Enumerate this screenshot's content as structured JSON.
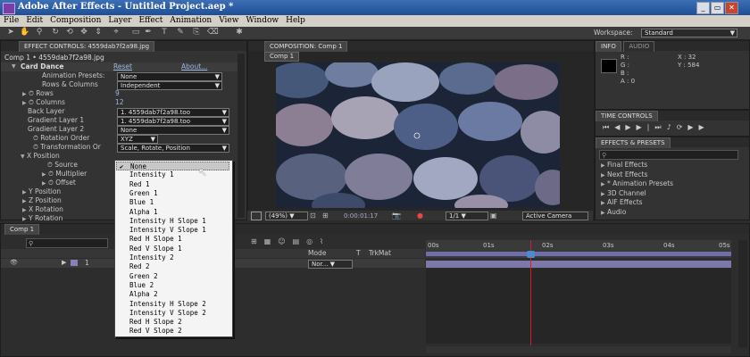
{
  "app": {
    "title": "Adobe After Effects - Untitled Project.aep *"
  },
  "menu": [
    "File",
    "Edit",
    "Composition",
    "Layer",
    "Effect",
    "Animation",
    "View",
    "Window",
    "Help"
  ],
  "workspace": {
    "label": "Workspace:",
    "value": "Standard"
  },
  "effect_controls": {
    "tab": "EFFECT CONTROLS: 4559dab7f2a98.jpg",
    "layer_path": "Comp 1 • 4559dab7f2a98.jpg",
    "effect_name": "Card Dance",
    "reset": "Reset",
    "about": "About...",
    "rows": [
      {
        "label": "Animation Presets:",
        "value": "None"
      },
      {
        "label": "Rows & Columns",
        "value": "Independent"
      },
      {
        "label": "Rows",
        "value": "9"
      },
      {
        "label": "Columns",
        "value": "12"
      },
      {
        "label": "Back Layer",
        "value": "1. 4559dab7f2a98.too"
      },
      {
        "label": "Gradient Layer 1",
        "value": "1. 4559dab7f2a98.too"
      },
      {
        "label": "Gradient Layer 2",
        "value": "None"
      },
      {
        "label": "Rotation Order",
        "value": "XYZ"
      },
      {
        "label": "Transformation Or",
        "value": "Scale, Rotate, Position"
      },
      {
        "label": "X Position",
        "value": ""
      },
      {
        "label": "Source",
        "value": ""
      },
      {
        "label": "Multiplier",
        "value": ""
      },
      {
        "label": "Offset",
        "value": ""
      },
      {
        "label": "Y Position",
        "value": ""
      },
      {
        "label": "Z Position",
        "value": ""
      },
      {
        "label": "X Rotation",
        "value": ""
      },
      {
        "label": "Y Rotation",
        "value": ""
      }
    ]
  },
  "source_menu": {
    "items": [
      "None",
      "Intensity 1",
      "Red 1",
      "Green 1",
      "Blue 1",
      "Alpha 1",
      "Intensity H Slope 1",
      "Intensity V Slope 1",
      "Red H Slope 1",
      "Red V Slope 1",
      "Intensity 2",
      "Red 2",
      "Green 2",
      "Blue 2",
      "Alpha 2",
      "Intensity H Slope 2",
      "Intensity V Slope 2",
      "Red H Slope 2",
      "Red V Slope 2"
    ],
    "selected": "None"
  },
  "composition": {
    "tab": "COMPOSITION: Comp 1",
    "sub_tab": "Comp 1",
    "zoom": "(49%)",
    "timecode": "0:00:01:17",
    "resolution": "1/1",
    "camera": "Active Camera"
  },
  "info": {
    "tab_info": "INFO",
    "tab_audio": "AUDIO",
    "r": "R :",
    "g": "G :",
    "b": "B :",
    "a": "A : 0",
    "x": "X : 32",
    "y": "Y : 584"
  },
  "time_controls": {
    "tab": "TIME CONTROLS"
  },
  "effects_presets": {
    "tab": "EFFECTS & PRESETS",
    "items": [
      "Final Effects",
      "Next Effects",
      "* Animation Presets",
      "3D Channel",
      "AIF Effects",
      "Audio"
    ]
  },
  "timeline": {
    "tab": "Comp 1",
    "cols": {
      "mode": "Mode",
      "t": "T",
      "trkmat": "TrkMat"
    },
    "layer_num": "1",
    "mode_value": "Nor...",
    "ruler": [
      "00s",
      "01s",
      "02s",
      "03s",
      "04s",
      "05s"
    ]
  },
  "colors": {
    "accent": "#3d6fb5",
    "playhead": "#d02020",
    "work_area": "#6e6ea8"
  }
}
